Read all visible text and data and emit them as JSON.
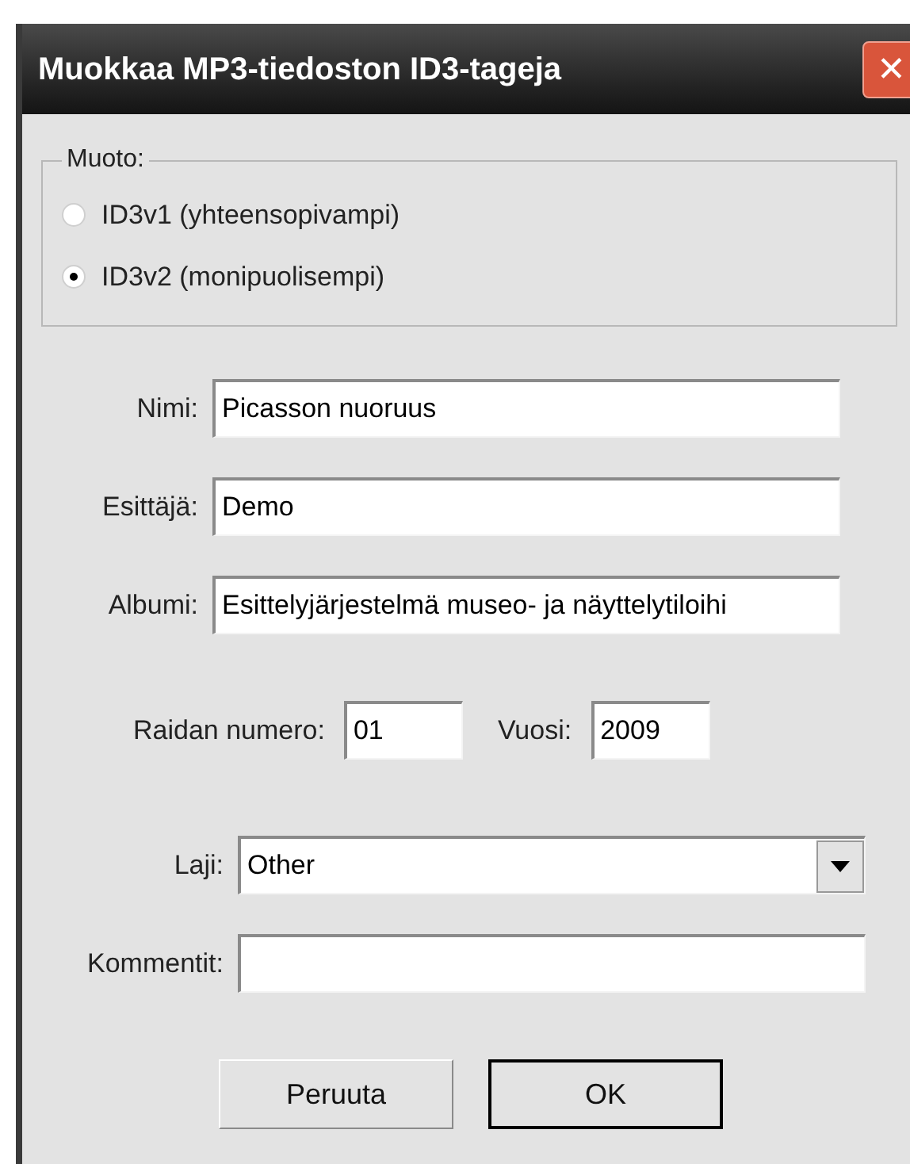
{
  "window": {
    "title": "Muokkaa MP3-tiedoston ID3-tageja",
    "close": "✕"
  },
  "format": {
    "legend": "Muoto:",
    "options": [
      {
        "label": "ID3v1 (yhteensopivampi)",
        "selected": false
      },
      {
        "label": "ID3v2 (monipuolisempi)",
        "selected": true
      }
    ]
  },
  "fields": [
    {
      "label": "Nimi:",
      "value": "Picasson nuoruus"
    },
    {
      "label": "Esittäjä:",
      "value": "Demo"
    },
    {
      "label": "Albumi:",
      "value": "Esittelyjärjestelmä museo- ja näyttelytiloihi"
    }
  ],
  "track": {
    "label": "Raidan numero:",
    "value": "01"
  },
  "year": {
    "label": "Vuosi:",
    "value": "2009"
  },
  "genre": {
    "label": "Laji:",
    "value": "Other"
  },
  "comment": {
    "label": "Kommentit:"
  },
  "buttons": [
    {
      "label": "Peruuta",
      "default": false
    },
    {
      "label": "OK",
      "default": true
    }
  ]
}
